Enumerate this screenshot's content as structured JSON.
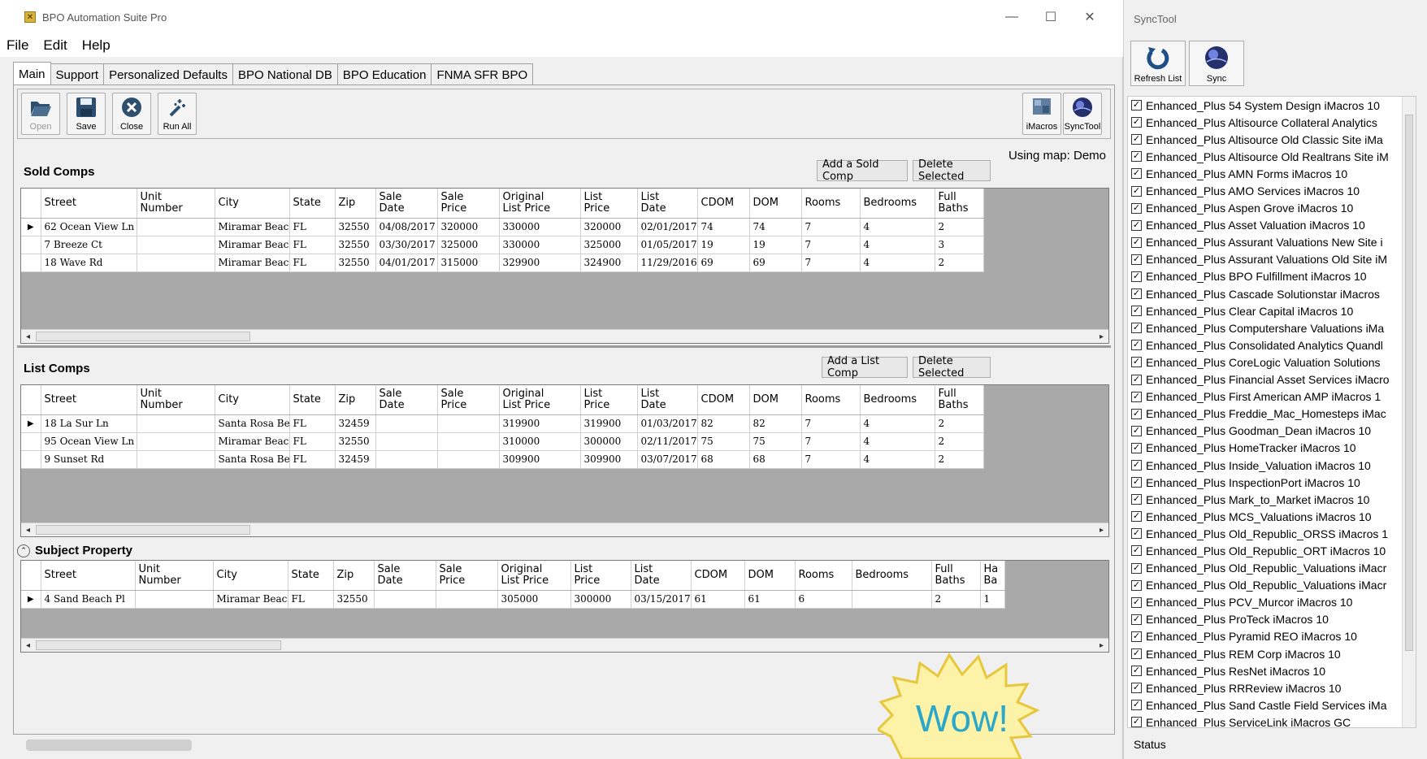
{
  "window": {
    "title": "BPO Automation Suite Pro",
    "icon": "app-icon",
    "minimize_glyph": "—",
    "maximize_glyph": "☐",
    "close_glyph": "✕"
  },
  "menu": [
    "File",
    "Edit",
    "Help"
  ],
  "tabs": [
    "Main",
    "Support",
    "Personalized Defaults",
    "BPO National DB",
    "BPO Education",
    "FNMA SFR BPO"
  ],
  "active_tab": "Main",
  "toolbar": {
    "open": "Open",
    "save": "Save",
    "close": "Close",
    "run_all": "Run All",
    "imacros": "iMacros",
    "synctool": "SyncTool"
  },
  "using_map": "Using map: Demo",
  "sold_comps": {
    "title": "Sold Comps",
    "add_button": "Add a Sold Comp",
    "delete_button": "Delete Selected",
    "columns": [
      [
        "Street"
      ],
      [
        "Unit",
        "Number"
      ],
      [
        "City"
      ],
      [
        "State"
      ],
      [
        "Zip"
      ],
      [
        "Sale",
        "Date"
      ],
      [
        "Sale",
        "Price"
      ],
      [
        "Original",
        "List Price"
      ],
      [
        "List",
        "Price"
      ],
      [
        "List",
        "Date"
      ],
      [
        "CDOM"
      ],
      [
        "DOM"
      ],
      [
        "Rooms"
      ],
      [
        "Bedrooms"
      ],
      [
        "Full",
        "Baths"
      ]
    ],
    "rows": [
      [
        "62 Ocean View Ln",
        "",
        "Miramar Beach",
        "FL",
        "32550",
        "04/08/2017",
        "320000",
        "330000",
        "320000",
        "02/01/2017",
        "74",
        "74",
        "7",
        "4",
        "2"
      ],
      [
        "7 Breeze Ct",
        "",
        "Miramar Beach",
        "FL",
        "32550",
        "03/30/2017",
        "325000",
        "330000",
        "325000",
        "01/05/2017",
        "19",
        "19",
        "7",
        "4",
        "3"
      ],
      [
        "18 Wave Rd",
        "",
        "Miramar Beach",
        "FL",
        "32550",
        "04/01/2017",
        "315000",
        "329900",
        "324900",
        "11/29/2016",
        "69",
        "69",
        "7",
        "4",
        "2"
      ]
    ]
  },
  "list_comps": {
    "title": "List Comps",
    "add_button": "Add a List Comp",
    "delete_button": "Delete Selected",
    "columns": [
      [
        "Street"
      ],
      [
        "Unit",
        "Number"
      ],
      [
        "City"
      ],
      [
        "State"
      ],
      [
        "Zip"
      ],
      [
        "Sale",
        "Date"
      ],
      [
        "Sale",
        "Price"
      ],
      [
        "Original",
        "List Price"
      ],
      [
        "List",
        "Price"
      ],
      [
        "List",
        "Date"
      ],
      [
        "CDOM"
      ],
      [
        "DOM"
      ],
      [
        "Rooms"
      ],
      [
        "Bedrooms"
      ],
      [
        "Full",
        "Baths"
      ]
    ],
    "rows": [
      [
        "18 La Sur Ln",
        "",
        "Santa Rosa Beach",
        "FL",
        "32459",
        "",
        "",
        "319900",
        "319900",
        "01/03/2017",
        "82",
        "82",
        "7",
        "4",
        "2"
      ],
      [
        "95 Ocean View Ln",
        "",
        "Miramar Beach",
        "FL",
        "32550",
        "",
        "",
        "310000",
        "300000",
        "02/11/2017",
        "75",
        "75",
        "7",
        "4",
        "2"
      ],
      [
        "9 Sunset Rd",
        "",
        "Santa Rosa Beach",
        "FL",
        "32459",
        "",
        "",
        "309900",
        "309900",
        "03/07/2017",
        "68",
        "68",
        "7",
        "4",
        "2"
      ]
    ]
  },
  "subject_property": {
    "title": "Subject Property",
    "columns": [
      [
        "Street"
      ],
      [
        "Unit",
        "Number"
      ],
      [
        "City"
      ],
      [
        "State"
      ],
      [
        "Zip"
      ],
      [
        "Sale",
        "Date"
      ],
      [
        "Sale",
        "Price"
      ],
      [
        "Original",
        "List Price"
      ],
      [
        "List",
        "Price"
      ],
      [
        "List",
        "Date"
      ],
      [
        "CDOM"
      ],
      [
        "DOM"
      ],
      [
        "Rooms"
      ],
      [
        "Bedrooms"
      ],
      [
        "Full",
        "Baths"
      ],
      [
        "Ha",
        "Ba"
      ]
    ],
    "rows": [
      [
        "4 Sand Beach Pl",
        "",
        "Miramar Beach",
        "FL",
        "32550",
        "",
        "",
        "305000",
        "300000",
        "03/15/2017",
        "61",
        "61",
        "6",
        "",
        "2",
        "1"
      ]
    ]
  },
  "synctool": {
    "title": "SyncTool",
    "refresh_label": "Refresh List",
    "sync_label": "Sync",
    "status": "Status",
    "items": [
      "Enhanced_Plus 54 System Design iMacros 10",
      "Enhanced_Plus Altisource Collateral Analytics",
      "Enhanced_Plus Altisource Old Classic Site iMa",
      "Enhanced_Plus Altisource Old Realtrans Site iM",
      "Enhanced_Plus AMN Forms iMacros 10",
      "Enhanced_Plus AMO Services iMacros 10",
      "Enhanced_Plus Aspen Grove iMacros 10",
      "Enhanced_Plus Asset Valuation iMacros 10",
      "Enhanced_Plus Assurant Valuations New Site i",
      "Enhanced_Plus Assurant Valuations Old Site iM",
      "Enhanced_Plus BPO Fulfillment iMacros 10",
      "Enhanced_Plus Cascade Solutionstar iMacros",
      "Enhanced_Plus Clear Capital iMacros 10",
      "Enhanced_Plus Computershare Valuations iMa",
      "Enhanced_Plus Consolidated Analytics Quandl",
      "Enhanced_Plus CoreLogic Valuation Solutions",
      "Enhanced_Plus Financial Asset Services iMacro",
      "Enhanced_Plus First American AMP iMacros 1",
      "Enhanced_Plus Freddie_Mac_Homesteps iMac",
      "Enhanced_Plus Goodman_Dean iMacros 10",
      "Enhanced_Plus HomeTracker iMacros 10",
      "Enhanced_Plus Inside_Valuation iMacros 10",
      "Enhanced_Plus InspectionPort iMacros 10",
      "Enhanced_Plus Mark_to_Market iMacros 10",
      "Enhanced_Plus MCS_Valuations iMacros 10",
      "Enhanced_Plus Old_Republic_ORSS iMacros 1",
      "Enhanced_Plus Old_Republic_ORT iMacros 10",
      "Enhanced_Plus Old_Republic_Valuations iMacr",
      "Enhanced_Plus Old_Republic_Valuations iMacr",
      "Enhanced_Plus PCV_Murcor iMacros 10",
      "Enhanced_Plus ProTeck iMacros 10",
      "Enhanced_Plus Pyramid REO iMacros 10",
      "Enhanced_Plus REM Corp iMacros 10",
      "Enhanced_Plus ResNet iMacros 10",
      "Enhanced_Plus RRReview iMacros 10",
      "Enhanced_Plus Sand Castle Field Services iMa",
      "Enhanced_Plus ServiceLink iMacros GC"
    ]
  },
  "overlay": {
    "wow_text": "Wow!",
    "wow_fill": "#fdf3a8",
    "wow_stroke": "#e7c73c",
    "wow_text_color": "#2aa7c9"
  }
}
